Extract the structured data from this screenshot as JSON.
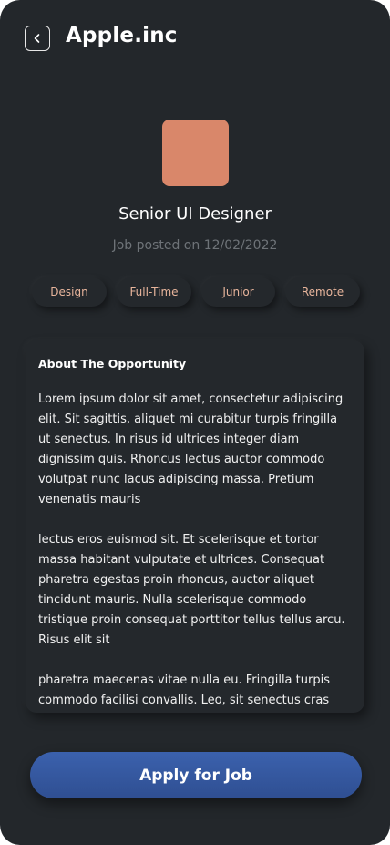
{
  "header": {
    "back_icon": "chevron-left-icon",
    "title": "Apple.inc"
  },
  "job": {
    "logo_color": "#d9876a",
    "title": "Senior UI Designer",
    "posted": "Job posted on 12/02/2022",
    "tags": [
      "Design",
      "Full-Time",
      "Junior",
      "Remote"
    ],
    "tag_text_color": "#e8b59c"
  },
  "about": {
    "heading": "About The Opportunity",
    "paragraphs": [
      "Lorem ipsum dolor sit amet, consectetur adipiscing elit. Sit sagittis, aliquet mi curabitur turpis fringilla ut senectus. In risus id ultrices integer diam dignissim quis. Rhoncus lectus auctor commodo volutpat nunc lacus adipiscing massa. Pretium venenatis mauris",
      "lectus eros euismod sit. Et scelerisque et tortor massa habitant vulputate et ultrices. Consequat pharetra egestas proin rhoncus, auctor aliquet tincidunt mauris. Nulla scelerisque commodo tristique proin consequat porttitor tellus tellus arcu. Risus elit sit",
      "pharetra maecenas vitae nulla eu. Fringilla turpis commodo facilisi convallis. Leo, sit senectus cras quis"
    ]
  },
  "actions": {
    "apply_label": "Apply for Job",
    "apply_color": "#3b61ad"
  },
  "theme": {
    "background": "#23272b"
  }
}
